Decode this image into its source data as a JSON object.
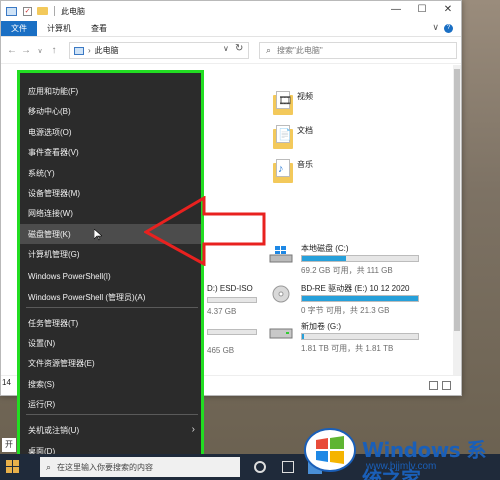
{
  "window": {
    "title": "此电脑",
    "title_check": "✓",
    "buttons": {
      "minimize": "—",
      "maximize": "☐",
      "close": "✕"
    }
  },
  "ribbon": {
    "tabs": [
      {
        "label": "文件",
        "active": true
      },
      {
        "label": "计算机",
        "active": false
      },
      {
        "label": "查看",
        "active": false
      }
    ],
    "expand": "∨",
    "help": "?"
  },
  "address": {
    "back": "←",
    "forward": "→",
    "history": "∨",
    "up": "↑",
    "separator": "›",
    "path": "此电脑",
    "dropdown": "∨",
    "refresh": "↻"
  },
  "search": {
    "icon": "⌕",
    "placeholder": "搜索\"此电脑\""
  },
  "folders": [
    {
      "label": "视频",
      "icon": "video-folder-icon",
      "glyph": "🎞"
    },
    {
      "label": "文档",
      "icon": "documents-folder-icon",
      "glyph": "📄"
    },
    {
      "label": "音乐",
      "icon": "music-folder-icon",
      "glyph": "♪"
    }
  ],
  "drives": [
    {
      "name": "本地磁盘 (C:)",
      "free": "69.2 GB 可用，共 111 GB",
      "fill": 0.38,
      "icon": "windows-drive-icon"
    },
    {
      "name": "BD-RE 驱动器 (E:) 10 12 2020",
      "free": "0 字节 可用，共 21.3 GB",
      "fill": 1.0,
      "icon": "optical-disc-icon"
    },
    {
      "name": "新加卷 (G:)",
      "free": "1.81 TB 可用，共 1.81 TB",
      "fill": 0.02,
      "icon": "hard-drive-icon"
    }
  ],
  "left_partial": {
    "d_label": "D:) ESD-ISO",
    "d_free": "4.37 GB",
    "f_free": "465 GB"
  },
  "status": {
    "count": "14"
  },
  "winx_menu": {
    "items": [
      "应用和功能(F)",
      "移动中心(B)",
      "电源选项(O)",
      "事件查看器(V)",
      "系统(Y)",
      "设备管理器(M)",
      "网络连接(W)",
      "磁盘管理(K)",
      "计算机管理(G)",
      "Windows PowerShell(I)",
      "Windows PowerShell (管理员)(A)",
      "任务管理器(T)",
      "设置(N)",
      "文件资源管理器(E)",
      "搜索(S)",
      "运行(R)",
      "关机或注销(U)",
      "桌面(D)"
    ],
    "highlighted": "磁盘管理(K)",
    "submenu_chevron": "›",
    "accent_border": "#22dd22"
  },
  "annotation": {
    "arrow_color": "#e8211f"
  },
  "taskbar": {
    "search_icon": "⌕",
    "search_placeholder": "在这里输入你要搜索的内容",
    "start_label": "开"
  },
  "watermark": {
    "title": "Windows 系统之家",
    "url": "www.bjjmlv.com"
  }
}
